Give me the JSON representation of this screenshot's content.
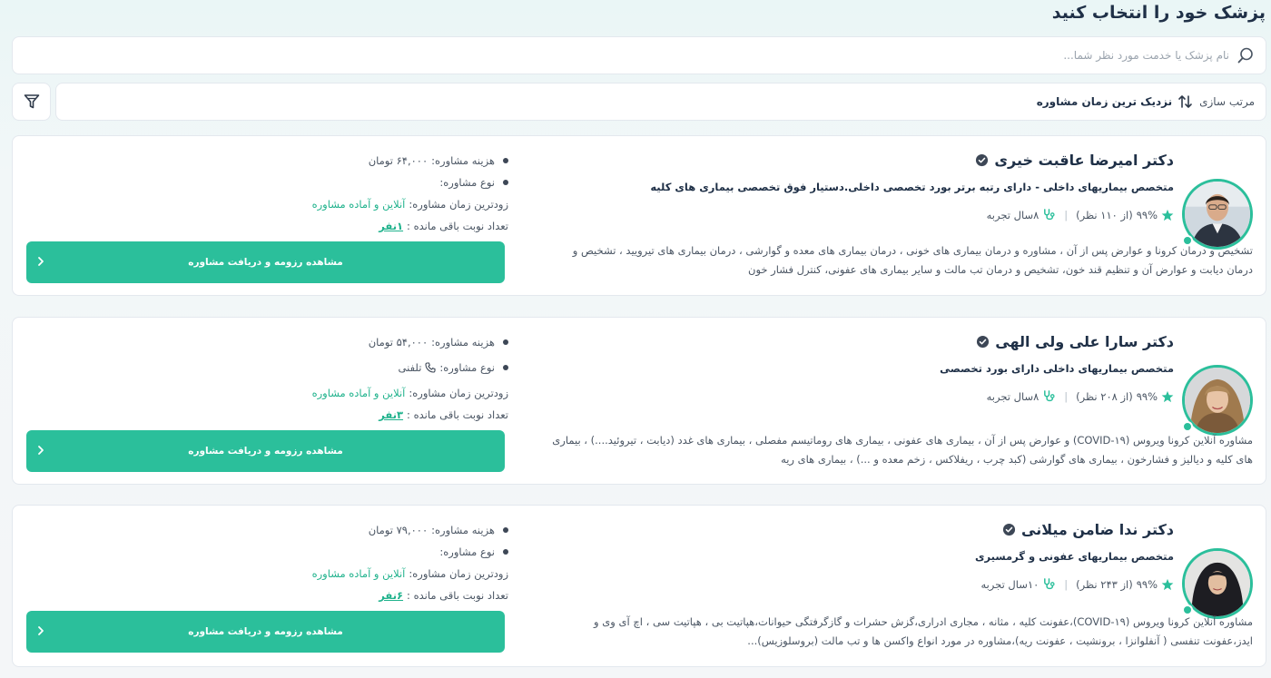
{
  "page": {
    "title": "پزشک خود را انتخاب کنید"
  },
  "search": {
    "placeholder": "نام پزشک یا خدمت مورد نظر شما..."
  },
  "sort": {
    "label": "مرتب سازی",
    "value": "نزدیک ترین زمان مشاوره"
  },
  "labels": {
    "fee": "هزینه مشاوره:",
    "type": "نوع مشاوره:",
    "earliest": "زودترین زمان مشاوره:",
    "remaining": "تعداد نوبت باقی مانده :",
    "cta": "مشاهده رزومه و دریافت مشاوره"
  },
  "colors": {
    "accent": "#2bbf9b",
    "title": "#1f3047",
    "text": "#4a5563"
  },
  "doctors": [
    {
      "name": "دکتر امیرضا عاقبت خیری",
      "specialty": "متخصص بیماریهای داخلی - دارای رتبه برتر بورد تخصصی داخلی.دستیار فوق تخصصی بیماری های کلیه",
      "rating": "۹۹%",
      "reviews": "(از ۱۱۰ نظر)",
      "experience": "۸سال تجربه",
      "desc_line1": "تشخیص و درمان کرونا و عوارض پس از آن ، مشاوره و درمان بیماری های خونی ، درمان بیماری های معده و گوارشی ، درمان بیماری های تیرویید ، تشخیص و",
      "desc_line2": "درمان دیابت و عوارض آن و تنظیم قند خون، تشخیص و درمان تب مالت و سایر بیماری های عفونی، کنترل فشار خون",
      "fee": "۶۴,۰۰۰ تومان",
      "type": "",
      "earliest": "آنلاین و آماده مشاوره",
      "remaining": "۱نفر"
    },
    {
      "name": "دکتر سارا علی ولی الهی",
      "specialty": "متخصص بیماریهای داخلی دارای بورد تخصصی",
      "rating": "۹۹%",
      "reviews": "(از ۲۰۸ نظر)",
      "experience": "۸سال تجربه",
      "desc_line1": "مشاوره آنلاین کرونا ویروس (COVID-۱۹) و عوارض پس از آن ، بیماری های عفونی ، بیماری های روماتیسم مفصلی ، بیماری های غدد (دیابت ، تیروئید....) ، بیماری",
      "desc_line2": "های کلیه و دیالیز و فشارخون ، بیماری های گوارشی (کبد چرب ، ریفلاکس ، زخم معده و ...) ، بیماری های ریه",
      "fee": "۵۴,۰۰۰ تومان",
      "type": "تلفنی",
      "earliest": "آنلاین و آماده مشاوره",
      "remaining": "۳نفر"
    },
    {
      "name": "دکتر ندا ضامن میلانی",
      "specialty": "متخصص بیماریهای عفونی و گرمسیری",
      "rating": "۹۹%",
      "reviews": "(از ۲۴۳ نظر)",
      "experience": "۱۰سال تجربه",
      "desc_line1": "مشاوره آنلاین کرونا ویروس (COVID-۱۹)،عفونت کلیه ، مثانه ، مجاری ادراری،گزش حشرات و گازگرفتگی حیوانات،هپاتیت بی ، هپاتیت سی ، اچ آی وی و",
      "desc_line2": "ایدز،عفونت تنفسی ( آنفلوانزا ، برونشیت ، عفونت ریه)،مشاوره در مورد انواع واکسن ها و تب مالت (بروسلوزیس)...",
      "fee": "۷۹,۰۰۰ تومان",
      "type": "",
      "earliest": "آنلاین و آماده مشاوره",
      "remaining": "۶نفر"
    }
  ]
}
